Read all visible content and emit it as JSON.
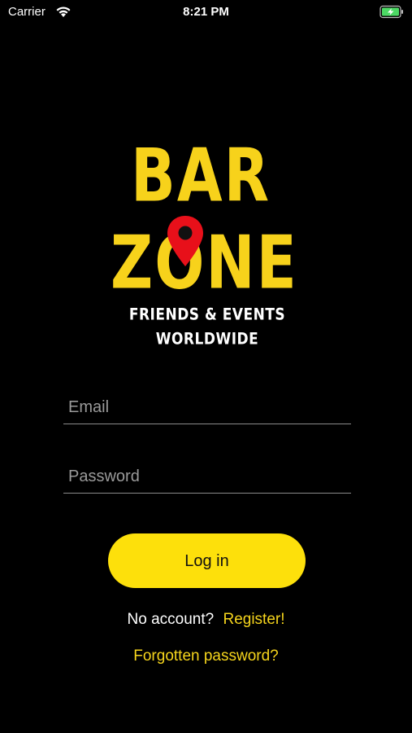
{
  "status_bar": {
    "carrier": "Carrier",
    "time": "8:21 PM"
  },
  "logo": {
    "line1": "BAR",
    "line2": "ZONE",
    "tagline1": "FRIENDS & EVENTS",
    "tagline2": "WORLDWIDE",
    "brand_color": "#f7d21b",
    "pin_color": "#e8101a"
  },
  "form": {
    "email_placeholder": "Email",
    "password_placeholder": "Password",
    "login_label": "Log in",
    "no_account_text": "No account?",
    "register_label": "Register!",
    "forgot_label": "Forgotten password?"
  },
  "colors": {
    "accent": "#fde00b",
    "link": "#f6d51c",
    "background": "#000000"
  }
}
